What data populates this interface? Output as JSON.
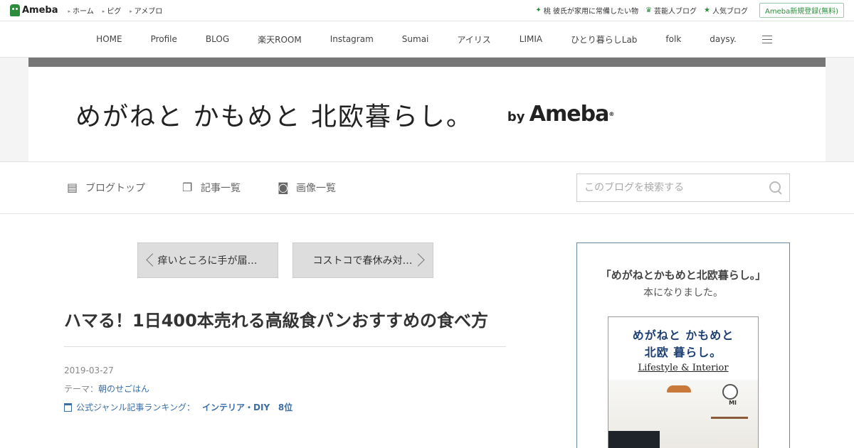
{
  "topbar": {
    "logo": "Ameba",
    "links": [
      "ホーム",
      "ピグ",
      "アメブロ"
    ],
    "right": [
      {
        "icon": "sparkle-icon",
        "label": "桃 彼氏が家用に常備したい物"
      },
      {
        "icon": "crown-icon",
        "label": "芸能人ブログ"
      },
      {
        "icon": "star-icon",
        "label": "人気ブログ"
      }
    ],
    "signup": "Ameba新規登録(無料)"
  },
  "blognav": [
    "HOME",
    "Profile",
    "BLOG",
    "楽天ROOM",
    "Instagram",
    "Sumai",
    "アイリス",
    "LIMIA",
    "ひとり暮らしLab",
    "folk",
    "daysy."
  ],
  "header": {
    "title": "めがねと かもめと 北欧暮らし。",
    "by": "by",
    "brand": "Ameba",
    "reg": "®"
  },
  "subnav": {
    "tabs": [
      {
        "icon": "document-icon",
        "label": "ブログトップ"
      },
      {
        "icon": "copy-icon",
        "label": "記事一覧"
      },
      {
        "icon": "camera-icon",
        "label": "画像一覧"
      }
    ],
    "search_placeholder": "このブログを検索する"
  },
  "pager": {
    "prev": "痒いところに手が届…",
    "next": "コストコで春休み対…"
  },
  "article": {
    "title": "ハマる！1日400本売れる高級食パンおすすめの食べ方",
    "date": "2019-03-27",
    "theme_label": "テーマ：",
    "theme": "朝のせごはん",
    "ranking_label": "公式ジャンル記事ランキング：",
    "ranking_genre": "インテリア・DIY",
    "ranking_rank": "8位"
  },
  "sidebar": {
    "promo_line1": "「めがねとかもめと北欧暮らし。」",
    "promo_line2": "本になりました。",
    "book": {
      "title1": "めがねと かもめと",
      "title2": "北欧 暮らし。",
      "subtitle": "Lifestyle & Interior",
      "author": "MI"
    }
  }
}
